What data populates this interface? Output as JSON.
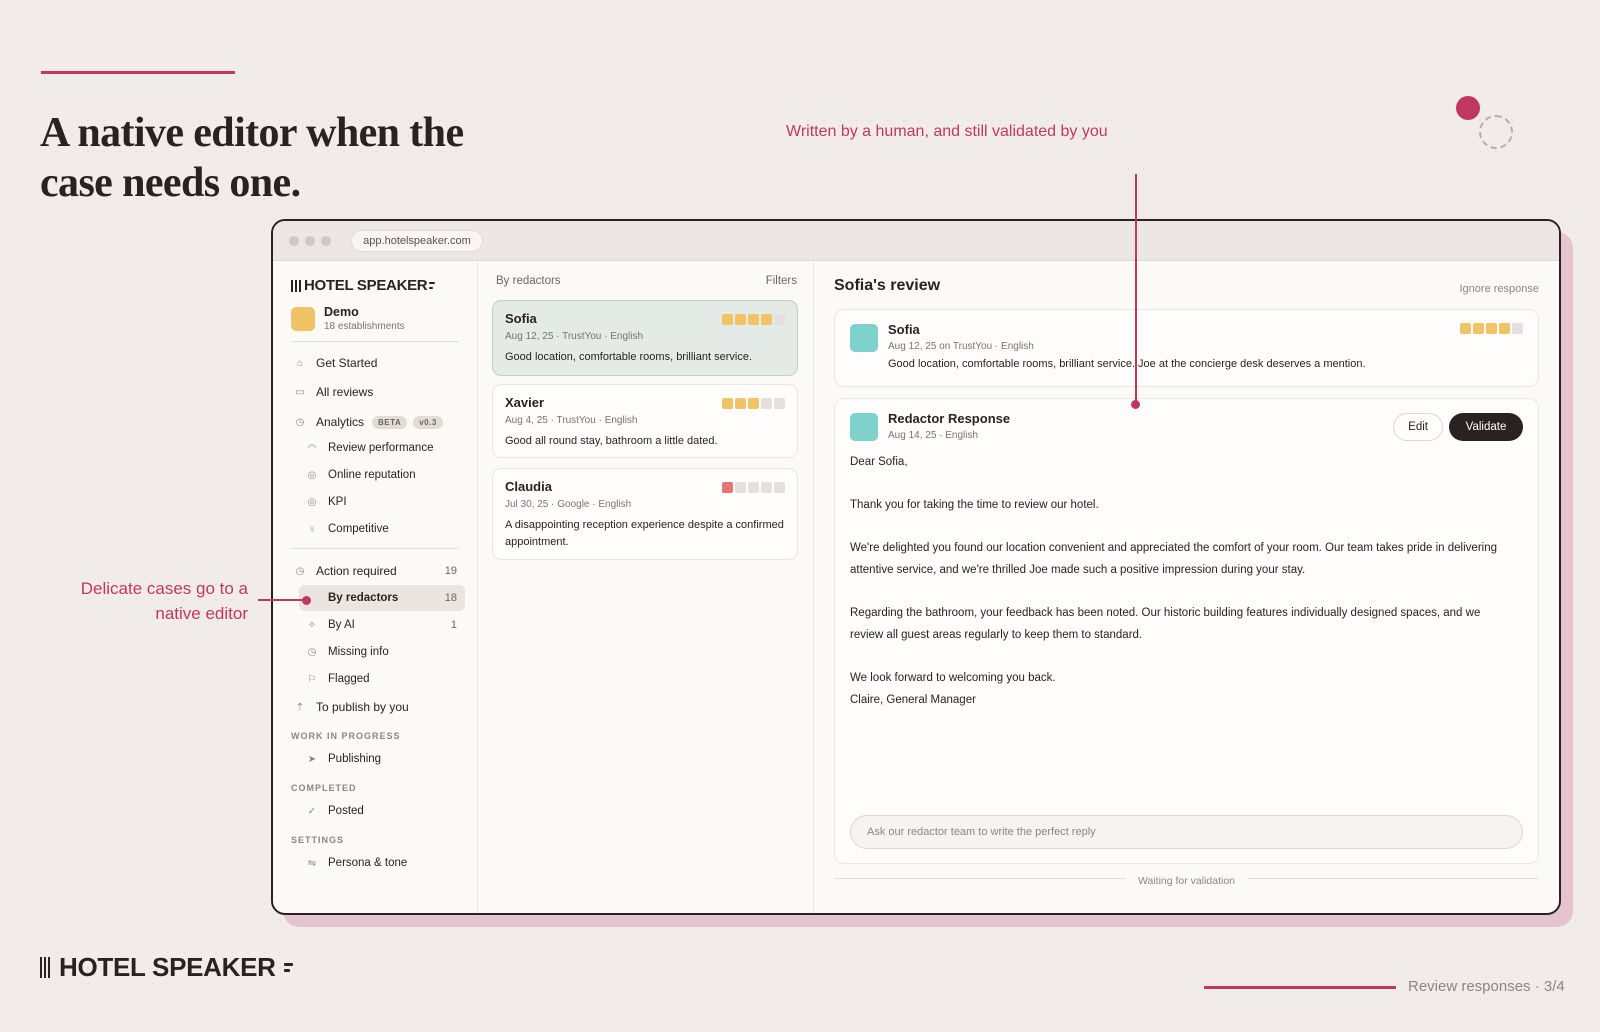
{
  "slide": {
    "headline": "A native editor when the case needs one.",
    "annotation_top": "Written by a human, and still validated by you",
    "annotation_left": "Delicate cases go to a native editor",
    "brand": "HOTEL SPEAKER",
    "page_label": "Review responses · 3/4",
    "accent_color": "#c2375f"
  },
  "browser": {
    "url": "app.hotelspeaker.com"
  },
  "sidebar": {
    "brand": "HOTEL SPEAKER",
    "workspace": {
      "name": "Demo",
      "subtitle": "18 establishments"
    },
    "items": [
      {
        "label": "Get Started",
        "icon": "home-icon"
      },
      {
        "label": "All reviews",
        "icon": "inbox-icon"
      },
      {
        "label": "Analytics",
        "icon": "clock-icon",
        "badges": [
          "BETA",
          "v0.3"
        ]
      },
      {
        "label": "Review performance",
        "icon": "gauge-icon"
      },
      {
        "label": "Online reputation",
        "icon": "target-icon"
      },
      {
        "label": "KPI",
        "icon": "target-icon"
      },
      {
        "label": "Competitive",
        "icon": "trophy-icon"
      },
      {
        "label": "Action required",
        "icon": "clock-icon",
        "count": "19"
      },
      {
        "label": "By redactors",
        "icon": "dot-icon",
        "count": "18"
      },
      {
        "label": "By AI",
        "icon": "sparkle-icon",
        "count": "1"
      },
      {
        "label": "Missing info",
        "icon": "clock-icon"
      },
      {
        "label": "Flagged",
        "icon": "flag-icon"
      },
      {
        "label": "To publish by you",
        "icon": "upload-icon"
      },
      {
        "label": "Publishing",
        "icon": "send-icon"
      },
      {
        "label": "Posted",
        "icon": "check-icon"
      },
      {
        "label": "Persona & tone",
        "icon": "sliders-icon"
      }
    ],
    "sections": {
      "work_in_progress": "WORK IN PROGRESS",
      "completed": "COMPLETED",
      "settings": "SETTINGS"
    }
  },
  "list": {
    "heading": "By redactors",
    "filters": "Filters",
    "reviews": [
      {
        "name": "Sofia",
        "meta": "Aug 12, 25 · TrustYou · English",
        "text": "Good location, comfortable rooms, brilliant service.",
        "rating": 4,
        "rating_max": 5
      },
      {
        "name": "Xavier",
        "meta": "Aug 4, 25 · TrustYou · English",
        "text": "Good all round stay, bathroom a little dated.",
        "rating": 3,
        "rating_max": 5
      },
      {
        "name": "Claudia",
        "meta": "Jul 30, 25 · Google · English",
        "text": "A disappointing reception experience despite a confirmed appointment.",
        "rating": 1,
        "rating_max": 5
      }
    ]
  },
  "detail": {
    "title": "Sofia's review",
    "ignore": "Ignore response",
    "review": {
      "name": "Sofia",
      "meta": "Aug 12, 25 on TrustYou · English",
      "text": "Good location, comfortable rooms, brilliant service. Joe at the concierge desk deserves a mention.",
      "rating": 4,
      "rating_max": 5
    },
    "response": {
      "title": "Redactor Response",
      "meta": "Aug 14, 25 · English",
      "edit_label": "Edit",
      "validate_label": "Validate",
      "greeting": "Dear Sofia,",
      "p1": "Thank you for taking the time to review our hotel.",
      "p2": "We're delighted you found our location convenient and appreciated the comfort of your room. Our team takes pride in delivering attentive service, and we're thrilled Joe made such a positive impression during your stay.",
      "p3": "Regarding the bathroom, your feedback has been noted. Our historic building features individually designed spaces, and we review all guest areas regularly to keep them to standard.",
      "p4": "We look forward to welcoming you back.",
      "signature": "Claire, General Manager",
      "ask_placeholder": "Ask our redactor team to write the perfect reply"
    },
    "status": "Waiting for validation"
  }
}
